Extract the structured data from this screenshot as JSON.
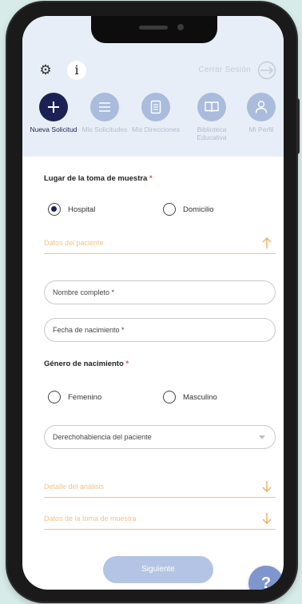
{
  "topbar": {
    "settings_icon": "gear-icon",
    "info_label": "i",
    "logout_label": "Cerrar Sesión",
    "logout_icon": "logout-arrow-icon"
  },
  "nav": {
    "items": [
      {
        "label": "Nueva Solicitud",
        "icon": "plus-icon",
        "active": true
      },
      {
        "label": "Mis Solicitudes",
        "icon": "list-icon",
        "active": false
      },
      {
        "label": "Mis Direcciones",
        "icon": "notebook-icon",
        "active": false
      },
      {
        "label": "Biblioteca Educativa",
        "icon": "book-icon",
        "active": false
      },
      {
        "label": "Mi Perfil",
        "icon": "user-icon",
        "active": false
      }
    ]
  },
  "form": {
    "location_label": "Lugar de la toma de muestra",
    "location_options": [
      {
        "label": "Hospital",
        "selected": true
      },
      {
        "label": "Domicilio",
        "selected": false
      }
    ],
    "patient_section": {
      "label": "Datos del paciente",
      "expanded": true
    },
    "fullname_placeholder": "Nombre completo *",
    "birthdate_placeholder": "Fecha de nacimiento *",
    "gender_label": "Género de nacimiento",
    "gender_options": [
      {
        "label": "Femenino",
        "selected": false
      },
      {
        "label": "Masculino",
        "selected": false
      }
    ],
    "insurance_placeholder": "Derechohabiencia del paciente",
    "analysis_section": {
      "label": "Detalle del análisis",
      "expanded": false
    },
    "sampling_section": {
      "label": "Datos de la toma de muestra",
      "expanded": false
    },
    "required_mark": "*",
    "next_label": "Siguiente"
  },
  "help_label": "?",
  "colors": {
    "primary": "#1c2155",
    "nav_inactive": "#aabbdc",
    "accent": "#f3c28a",
    "button": "#b4c4e4",
    "help": "#7f96cc",
    "required": "#e05050"
  }
}
